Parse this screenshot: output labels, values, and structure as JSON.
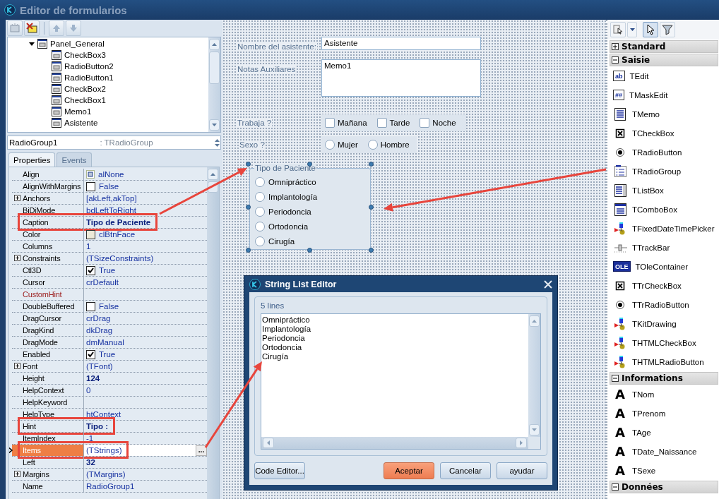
{
  "window": {
    "title": "Editor de formularios"
  },
  "tree": {
    "items": [
      {
        "label": "Panel_General",
        "expanded": true,
        "children": [
          {
            "label": "CheckBox3"
          },
          {
            "label": "RadioButton2"
          },
          {
            "label": "RadioButton1"
          },
          {
            "label": "CheckBox2"
          },
          {
            "label": "CheckBox1"
          },
          {
            "label": "Memo1"
          },
          {
            "label": "Asistente"
          }
        ]
      }
    ]
  },
  "component_selector": {
    "name": "RadioGroup1",
    "type": ": TRadioGroup"
  },
  "tabs": [
    {
      "label": "Properties",
      "selected": true
    },
    {
      "label": "Events",
      "selected": false
    }
  ],
  "properties": [
    {
      "name": "Align",
      "value": "alNone",
      "kind": "align",
      "selected": false
    },
    {
      "name": "AlignWithMargins",
      "value": "False",
      "kind": "check",
      "checked": false,
      "selected": false
    },
    {
      "name": "Anchors",
      "value": "[akLeft,akTop]",
      "kind": "text",
      "expandable": true,
      "selected": false
    },
    {
      "name": "BiDiMode",
      "value": "bdLeftToRight",
      "kind": "text",
      "selected": false
    },
    {
      "name": "Caption",
      "value": "Tipo de Paciente",
      "kind": "text",
      "bold": true,
      "annotated": true,
      "selected": false
    },
    {
      "name": "Color",
      "value": "clBtnFace",
      "kind": "color",
      "selected": false
    },
    {
      "name": "Columns",
      "value": "1",
      "kind": "text",
      "selected": false
    },
    {
      "name": "Constraints",
      "value": "(TSizeConstraints)",
      "kind": "text",
      "expandable": true,
      "selected": false
    },
    {
      "name": "Ctl3D",
      "value": "True",
      "kind": "check",
      "checked": true,
      "selected": false
    },
    {
      "name": "Cursor",
      "value": "crDefault",
      "kind": "text",
      "selected": false
    },
    {
      "name": "CustomHint",
      "kind": "text",
      "color": "#9b1b1b",
      "selected": false
    },
    {
      "name": "DoubleBuffered",
      "value": "False",
      "kind": "check",
      "checked": false,
      "selected": false
    },
    {
      "name": "DragCursor",
      "value": "crDrag",
      "kind": "text",
      "selected": false
    },
    {
      "name": "DragKind",
      "value": "dkDrag",
      "kind": "text",
      "selected": false
    },
    {
      "name": "DragMode",
      "value": "dmManual",
      "kind": "text",
      "selected": false
    },
    {
      "name": "Enabled",
      "value": "True",
      "kind": "check",
      "checked": true,
      "selected": false
    },
    {
      "name": "Font",
      "value": "(TFont)",
      "kind": "text",
      "expandable": true,
      "selected": false
    },
    {
      "name": "Height",
      "value": "124",
      "kind": "text",
      "bold": true,
      "selected": false
    },
    {
      "name": "HelpContext",
      "value": "0",
      "kind": "text",
      "selected": false
    },
    {
      "name": "HelpKeyword",
      "kind": "text",
      "selected": false
    },
    {
      "name": "HelpType",
      "value": "htContext",
      "kind": "text",
      "selected": false
    },
    {
      "name": "Hint",
      "value": "Tipo :",
      "kind": "text",
      "bold": true,
      "annotated": true,
      "selected": false
    },
    {
      "name": "ItemIndex",
      "value": "-1",
      "kind": "text",
      "selected": false
    },
    {
      "name": "Items",
      "value": "(TStrings)",
      "kind": "text",
      "annotated": true,
      "selected": true,
      "editor_button": "..."
    },
    {
      "name": "Left",
      "value": "32",
      "kind": "text",
      "bold": true,
      "selected": false
    },
    {
      "name": "Margins",
      "value": "(TMargins)",
      "kind": "text",
      "expandable": true,
      "selected": false
    },
    {
      "name": "Name",
      "value": "RadioGroup1",
      "kind": "text",
      "selected": false
    }
  ],
  "form": {
    "name_label": "Nombre del asistente:",
    "name_value": "Asistente",
    "notes_label": "Notas Auxiliares",
    "notes_value": "Memo1",
    "work_label": "Trabaja ?",
    "work_options": [
      {
        "label": "Mañana",
        "checked": false
      },
      {
        "label": "Tarde",
        "checked": false
      },
      {
        "label": "Noche",
        "checked": false
      }
    ],
    "sex_label": "Sexo ?",
    "sex_options": [
      {
        "label": "Mujer",
        "selected": false
      },
      {
        "label": "Hombre",
        "selected": false
      }
    ],
    "radio_group": {
      "caption": "Tipo de Paciente",
      "designer_selected": true,
      "items": [
        {
          "label": "Omnipráctico",
          "selected": false
        },
        {
          "label": "Implantología",
          "selected": false
        },
        {
          "label": "Periodoncia",
          "selected": false
        },
        {
          "label": "Ortodoncia",
          "selected": false
        },
        {
          "label": "Cirugía",
          "selected": false
        }
      ]
    }
  },
  "dialog": {
    "title": "String List Editor",
    "line_count": "5 lines",
    "lines": [
      "Omnipráctico",
      "Implantología",
      "Periodoncia",
      "Ortodoncia",
      "Cirugía"
    ],
    "buttons": [
      {
        "label": "Code Editor...",
        "default": false
      },
      {
        "label": "Aceptar",
        "default": true
      },
      {
        "label": "Cancelar",
        "default": false
      },
      {
        "label": "ayudar",
        "default": false
      }
    ]
  },
  "palette": {
    "toolbar": [
      {
        "kind": "select",
        "selected": false
      },
      {
        "kind": "dropdown",
        "selected": false
      },
      {
        "kind": "pointer",
        "selected": true
      },
      {
        "kind": "filter",
        "selected": false
      }
    ],
    "categories": [
      {
        "label": "Standard",
        "expanded": false
      },
      {
        "label": "Saisie",
        "expanded": true,
        "items": [
          {
            "label": "TEdit",
            "kind": "edit",
            "icon_text": "ab"
          },
          {
            "label": "TMaskEdit",
            "kind": "edit",
            "icon_text": "##"
          },
          {
            "label": "TMemo",
            "kind": "memo"
          },
          {
            "label": "TCheckBox",
            "kind": "checkbox"
          },
          {
            "label": "TRadioButton",
            "kind": "radio"
          },
          {
            "label": "TRadioGroup",
            "kind": "radiogroup"
          },
          {
            "label": "TListBox",
            "kind": "listbox"
          },
          {
            "label": "TComboBox",
            "kind": "combobox"
          },
          {
            "label": "TFixedDateTimePicker",
            "kind": "component"
          },
          {
            "label": "TTrackBar",
            "kind": "trackbar"
          },
          {
            "label": "TOleContainer",
            "kind": "ole",
            "icon_text": "OLE"
          },
          {
            "label": "TTrCheckBox",
            "kind": "checkbox"
          },
          {
            "label": "TTrRadioButton",
            "kind": "radio"
          },
          {
            "label": "TKitDrawing",
            "kind": "component"
          },
          {
            "label": "THTMLCheckBox",
            "kind": "component"
          },
          {
            "label": "THTMLRadioButton",
            "kind": "component"
          }
        ]
      },
      {
        "label": "Informations",
        "expanded": true,
        "items": [
          {
            "label": "TNom",
            "kind": "letter",
            "icon_text": "A"
          },
          {
            "label": "TPrenom",
            "kind": "letter",
            "icon_text": "A"
          },
          {
            "label": "TAge",
            "kind": "letter",
            "icon_text": "A"
          },
          {
            "label": "TDate_Naissance",
            "kind": "letter",
            "icon_text": "A"
          },
          {
            "label": "TSexe",
            "kind": "letter",
            "icon_text": "A"
          }
        ]
      },
      {
        "label": "Données",
        "expanded": true
      }
    ]
  }
}
